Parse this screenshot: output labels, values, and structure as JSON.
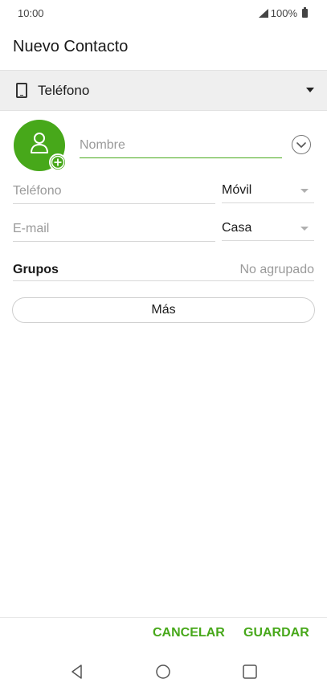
{
  "status_bar": {
    "time": "10:00",
    "battery": "100%",
    "icons": [
      "signal-icon",
      "battery-icon"
    ]
  },
  "header": {
    "title": "Nuevo Contacto"
  },
  "account": {
    "label": "Teléfono",
    "icon": "phone-icon"
  },
  "form": {
    "name": {
      "placeholder": "Nombre",
      "value": ""
    },
    "phone": {
      "placeholder": "Teléfono",
      "value": "",
      "type": "Móvil"
    },
    "email": {
      "placeholder": "E-mail",
      "value": "",
      "type": "Casa"
    },
    "groups": {
      "label": "Grupos",
      "value": "No agrupado"
    },
    "more_label": "Más"
  },
  "actions": {
    "cancel_label": "CANCELAR",
    "save_label": "GUARDAR"
  },
  "nav": {
    "icons": [
      "back-icon",
      "home-icon",
      "recents-icon"
    ]
  },
  "colors": {
    "accent": "#47a81a",
    "account_bar": "#efefef",
    "placeholder": "#9a9a9a"
  }
}
